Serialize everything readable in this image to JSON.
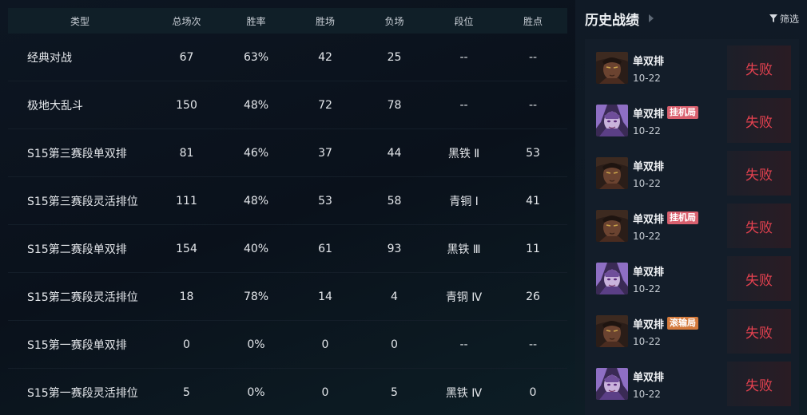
{
  "stats": {
    "columns": [
      "类型",
      "总场次",
      "胜率",
      "胜场",
      "负场",
      "段位",
      "胜点"
    ],
    "rows": [
      [
        "经典对战",
        "67",
        "63%",
        "42",
        "25",
        "--",
        "--"
      ],
      [
        "极地大乱斗",
        "150",
        "48%",
        "72",
        "78",
        "--",
        "--"
      ],
      [
        "S15第三赛段单双排",
        "81",
        "46%",
        "37",
        "44",
        "黑铁 Ⅱ",
        "53"
      ],
      [
        "S15第三赛段灵活排位",
        "111",
        "48%",
        "53",
        "58",
        "青铜 Ⅰ",
        "41"
      ],
      [
        "S15第二赛段单双排",
        "154",
        "40%",
        "61",
        "93",
        "黑铁 Ⅲ",
        "11"
      ],
      [
        "S15第二赛段灵活排位",
        "18",
        "78%",
        "14",
        "4",
        "青铜 Ⅳ",
        "26"
      ],
      [
        "S15第一赛段单双排",
        "0",
        "0%",
        "0",
        "0",
        "--",
        "--"
      ],
      [
        "S15第一赛段灵活排位",
        "5",
        "0%",
        "0",
        "5",
        "黑铁 Ⅳ",
        "0"
      ]
    ]
  },
  "history": {
    "title": "历史战绩",
    "filter_label": "筛选",
    "matches": [
      {
        "mode": "单双排",
        "tag": "",
        "tag_type": "",
        "date": "10-22",
        "result": "失败",
        "champion_icon": "champion-portrait-dark-skin"
      },
      {
        "mode": "单双排",
        "tag": "挂机局",
        "tag_type": "afk",
        "date": "10-22",
        "result": "失败",
        "champion_icon": "champion-portrait-purple"
      },
      {
        "mode": "单双排",
        "tag": "",
        "tag_type": "",
        "date": "10-22",
        "result": "失败",
        "champion_icon": "champion-portrait-dark-skin"
      },
      {
        "mode": "单双排",
        "tag": "挂机局",
        "tag_type": "afk",
        "date": "10-22",
        "result": "失败",
        "champion_icon": "champion-portrait-dark-skin"
      },
      {
        "mode": "单双排",
        "tag": "",
        "tag_type": "",
        "date": "10-22",
        "result": "失败",
        "champion_icon": "champion-portrait-purple"
      },
      {
        "mode": "单双排",
        "tag": "滚输局",
        "tag_type": "snowball",
        "date": "10-22",
        "result": "失败",
        "champion_icon": "champion-portrait-dark-skin"
      },
      {
        "mode": "单双排",
        "tag": "",
        "tag_type": "",
        "date": "10-22",
        "result": "失败",
        "champion_icon": "champion-portrait-purple"
      }
    ]
  },
  "colors": {
    "loss_text": "#e2414f",
    "tag_afk": "#d9606e",
    "tag_snowball": "#d47a3c"
  }
}
